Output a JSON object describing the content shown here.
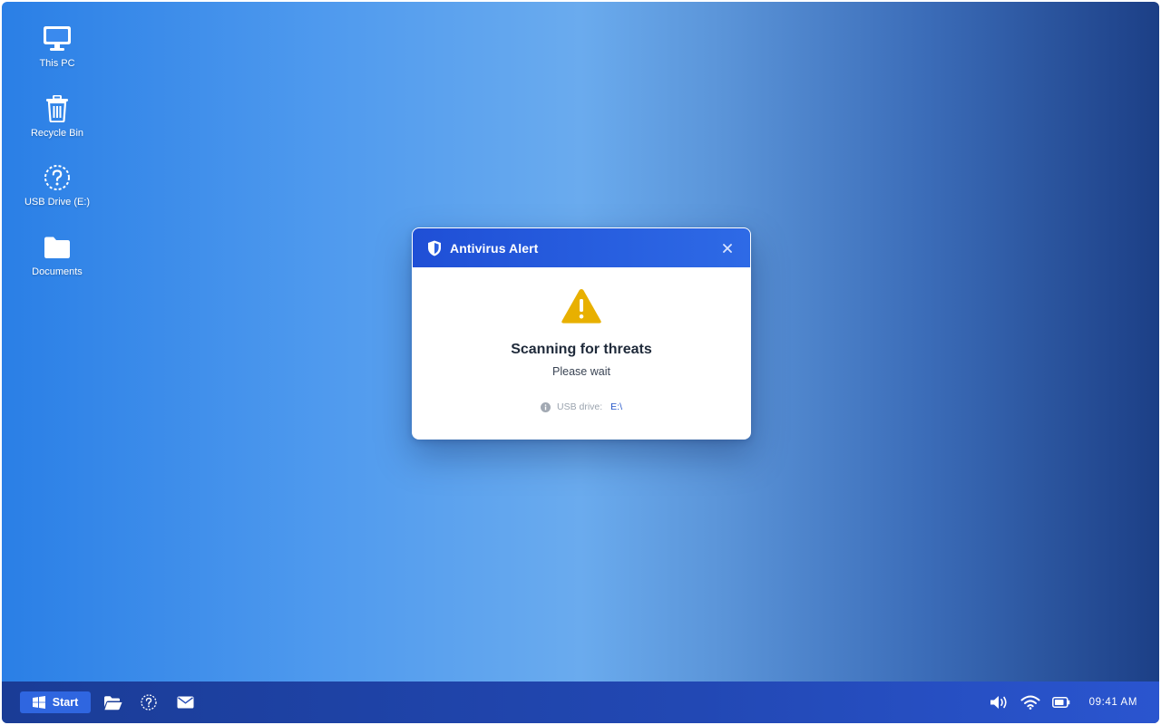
{
  "desktop": {
    "icons": [
      {
        "label": "This PC",
        "icon": "monitor-icon"
      },
      {
        "label": "Recycle Bin",
        "icon": "trash-icon"
      },
      {
        "label": "USB Drive (E:)",
        "icon": "question-circle-icon"
      },
      {
        "label": "Documents",
        "icon": "folder-icon"
      }
    ]
  },
  "dialog": {
    "title": "Antivirus Alert",
    "title_icon": "shield-icon",
    "close_icon": "close-icon",
    "warning_icon": "warning-triangle-icon",
    "heading": "Scanning for threats",
    "subtext": "Please wait",
    "info_label": "USB drive:",
    "info_value": "E:\\",
    "colors": {
      "header": "#2a5fe0",
      "warning": "#e8b000",
      "link": "#2456c9"
    }
  },
  "taskbar": {
    "start_label": "Start",
    "pinned": [
      {
        "icon": "folder-open-icon"
      },
      {
        "icon": "help-circle-icon"
      },
      {
        "icon": "mail-icon"
      }
    ],
    "tray": [
      {
        "icon": "volume-icon"
      },
      {
        "icon": "wifi-icon"
      },
      {
        "icon": "battery-icon"
      }
    ],
    "clock": "09:41 AM"
  }
}
